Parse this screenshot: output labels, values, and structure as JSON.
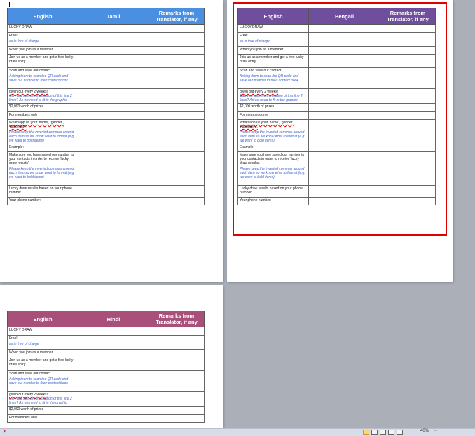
{
  "colors": {
    "tamil_header": "#4a8fe0",
    "bengali_header": "#6f4e9e",
    "hindi_header": "#a9507a",
    "highlight": "#e00000"
  },
  "row_labels": [
    {
      "text": "LUCKY DRAW"
    },
    {
      "text": "Free!",
      "note": "as in free of charge"
    },
    {
      "text": "When you join as a member"
    },
    {
      "text": "Join us as a member and get a free lucky draw entry"
    },
    {
      "text": "Scan and save our contact",
      "note": "Asking them to scan the QR code and save our number to their contact book"
    },
    {
      "text": "given out every 2 weeks!",
      "note2": "Can you split the translation of this line 2 lines? As we need to fit in the graphic"
    },
    {
      "text": "$2,000 worth of prizes"
    },
    {
      "text": "For members only"
    },
    {
      "text": "Whatsapp us your 'name', 'gender', 'nationality'.",
      "note": "Please keep the inverted commas around each item so we know what to format (e.g. we want to bold items)"
    },
    {
      "text": "Example:"
    },
    {
      "text": "Make sure you have saved our number to your contacts in order to receive 'lucky draw results'.",
      "note": "Please keep the inverted commas around each item so we know what to format (e.g. we want to bold items)"
    },
    {
      "text": "Lucky draw results based on your phone number"
    },
    {
      "text": "Your phone number:"
    }
  ],
  "tables": {
    "tamil": {
      "col1": "English",
      "col2": "Tamil",
      "col3": "Remarks from Translator, if any"
    },
    "bengali": {
      "col1": "English",
      "col2": "Bengali",
      "col3": "Remarks from Translator, if any"
    },
    "hindi": {
      "col1": "English",
      "col2": "Hindi",
      "col3": "Remarks from Translator, if any"
    }
  },
  "statusbar": {
    "zoom": "40%"
  }
}
